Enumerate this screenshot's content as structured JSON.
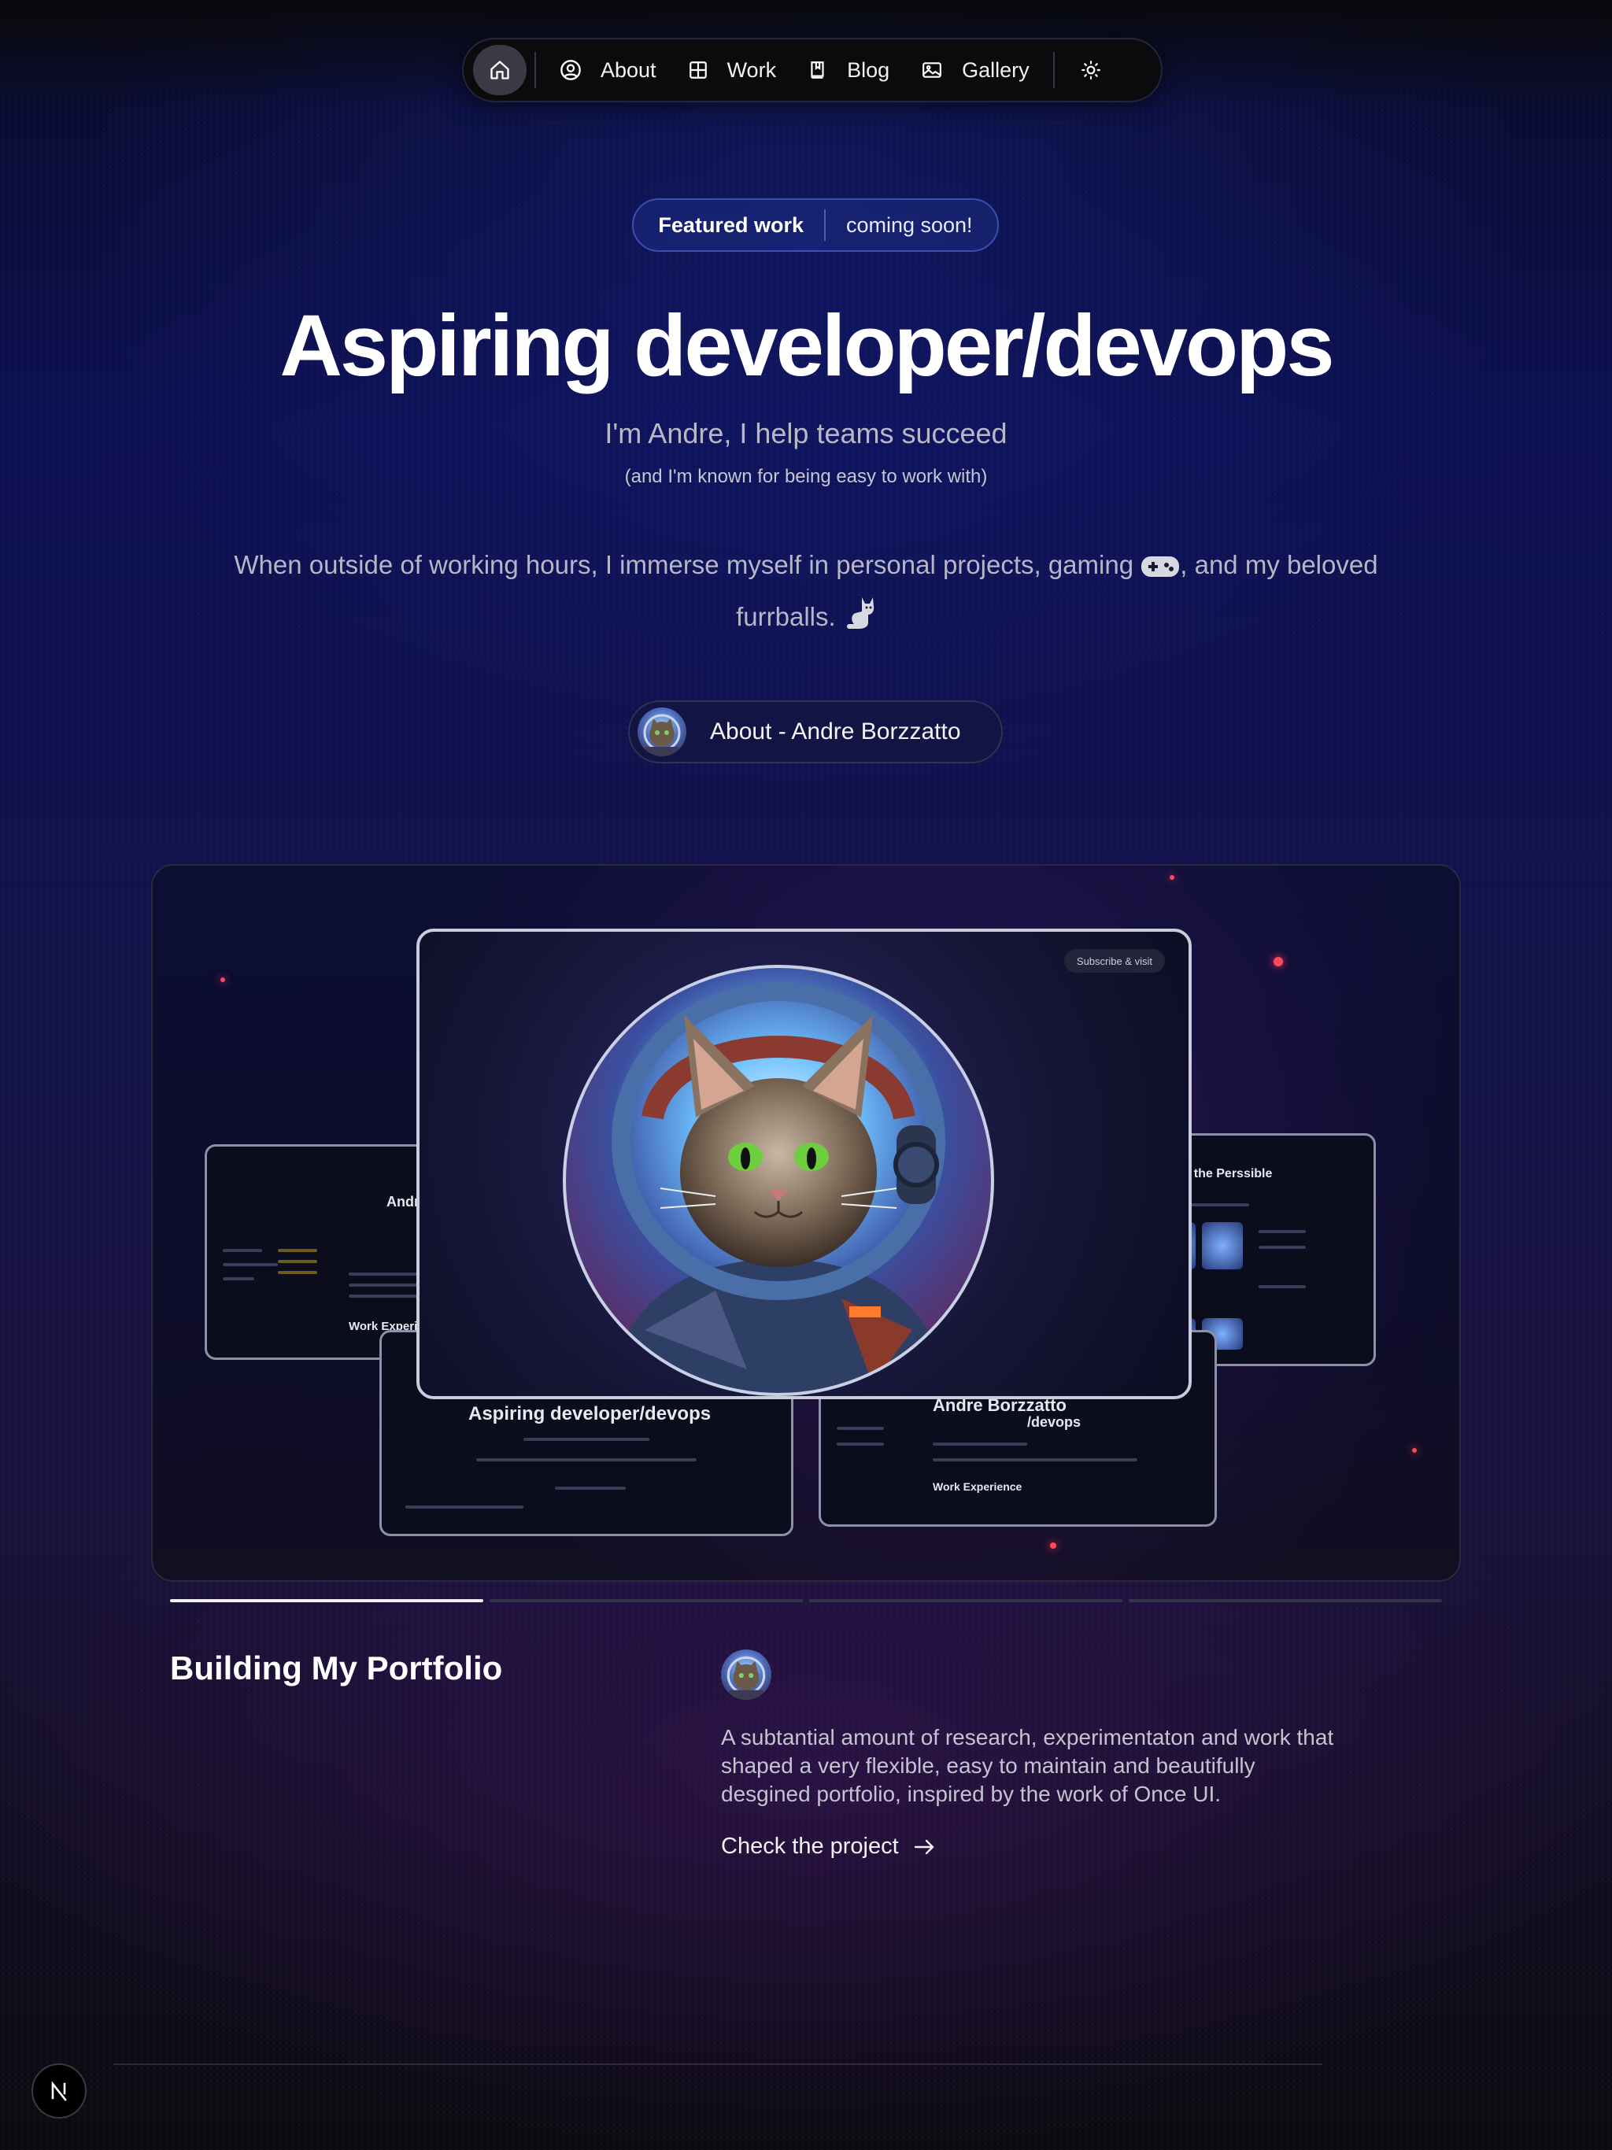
{
  "nav": {
    "items": [
      {
        "label": "About",
        "icon": "person-circle-icon"
      },
      {
        "label": "Work",
        "icon": "grid-icon"
      },
      {
        "label": "Blog",
        "icon": "book-icon"
      },
      {
        "label": "Gallery",
        "icon": "image-icon"
      }
    ],
    "home_icon": "home-icon",
    "theme_icon": "sun-icon"
  },
  "hero": {
    "badge_strong": "Featured work",
    "badge_soft": "coming soon!",
    "title": "Aspiring developer/devops",
    "subtitle": "I'm Andre, I help teams succeed",
    "note": "(and I'm known for being easy to work with)",
    "para_part1": "When outside of working hours, I immerse myself in personal projects, gaming",
    "para_part2": ", and my beloved furrballs.",
    "about_button": "About - Andre Borzzatto"
  },
  "showcase": {
    "subscribe_label": "Subscribe & visit",
    "mini_title_left": "Aspiring developer/devops",
    "mini_title_right": "Andre Borzzatto",
    "mini_title_right2": "/devops",
    "mini_section_left": "Work Experience",
    "mini_section_right": "Work Experience",
    "mini_title_left_top": "Andr",
    "mini_title_far_right": "...iche the Perssible",
    "progress_active": 0,
    "progress_count": 4
  },
  "project": {
    "title": "Building My Portfolio",
    "description": "A subtantial amount of research, experimentaton and work that shaped a very flexible, easy to maintain and beautifully desgined portfolio, inspired by the work of Once UI.",
    "link_label": "Check the project"
  },
  "colors": {
    "accent": "#3a4fb0",
    "background_top": "#0d1052",
    "background_bottom": "#0b0b10"
  }
}
